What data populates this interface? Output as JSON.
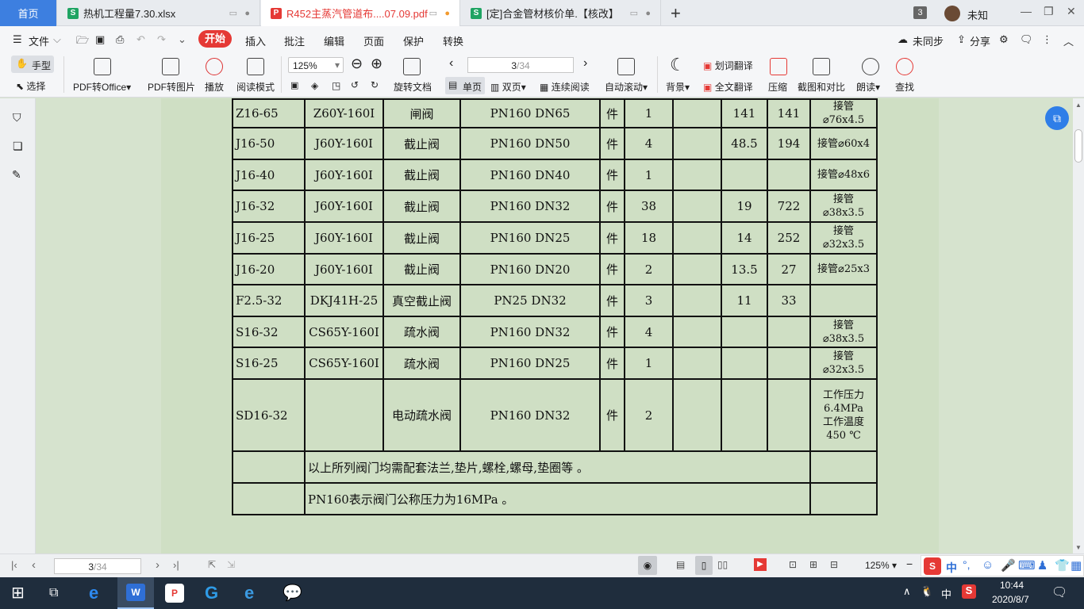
{
  "tabs": {
    "home": "首页",
    "xlsx": "热机工程量7.30.xlsx",
    "pdf": "R452主蒸汽管道布....07.09.pdf",
    "doc": "[定]合金管材核价单.【核改】",
    "count": "3",
    "user": "未知"
  },
  "menu": {
    "file": "文件",
    "start": "开始",
    "insert": "插入",
    "annotate": "批注",
    "edit": "编辑",
    "page": "页面",
    "protect": "保护",
    "convert": "转换",
    "sync": "未同步",
    "share": "分享"
  },
  "toolbar": {
    "hand": "手型",
    "select": "选择",
    "pdf_office": "PDF转Office",
    "pdf_img": "PDF转图片",
    "play": "播放",
    "read_mode": "阅读模式",
    "zoom": "125%",
    "page_current": "3",
    "page_total": "/34",
    "rotate": "旋转文档",
    "single": "单页",
    "double": "双页",
    "continuous": "连续阅读",
    "autoscroll": "自动滚动",
    "background": "背景",
    "word_translate": "划词翻译",
    "full_translate": "全文翻译",
    "compress": "压缩",
    "screenshot": "截图和对比",
    "read_aloud": "朗读",
    "find": "查找"
  },
  "table": {
    "rows": [
      {
        "code": "Z16-65",
        "model": "Z60Y-160I",
        "name": "闸阀",
        "spec": "PN160 DN65",
        "unit": "件",
        "qty": "1",
        "blank": "",
        "weight": "141",
        "total": "141",
        "note": "接管\n⌀76x4.5"
      },
      {
        "code": "J16-50",
        "model": "J60Y-160I",
        "name": "截止阀",
        "spec": "PN160 DN50",
        "unit": "件",
        "qty": "4",
        "blank": "",
        "weight": "48.5",
        "total": "194",
        "note": "接管⌀60x4"
      },
      {
        "code": "J16-40",
        "model": "J60Y-160I",
        "name": "截止阀",
        "spec": "PN160 DN40",
        "unit": "件",
        "qty": "1",
        "blank": "",
        "weight": "",
        "total": "",
        "note": "接管⌀48x6"
      },
      {
        "code": "J16-32",
        "model": "J60Y-160I",
        "name": "截止阀",
        "spec": "PN160 DN32",
        "unit": "件",
        "qty": "38",
        "blank": "",
        "weight": "19",
        "total": "722",
        "note": "接管\n⌀38x3.5"
      },
      {
        "code": "J16-25",
        "model": "J60Y-160I",
        "name": "截止阀",
        "spec": "PN160 DN25",
        "unit": "件",
        "qty": "18",
        "blank": "",
        "weight": "14",
        "total": "252",
        "note": "接管\n⌀32x3.5"
      },
      {
        "code": "J16-20",
        "model": "J60Y-160I",
        "name": "截止阀",
        "spec": "PN160 DN20",
        "unit": "件",
        "qty": "2",
        "blank": "",
        "weight": "13.5",
        "total": "27",
        "note": "接管⌀25x3"
      },
      {
        "code": "F2.5-32",
        "model": "DKJ41H-25",
        "name": "真空截止阀",
        "spec": "PN25 DN32",
        "unit": "件",
        "qty": "3",
        "blank": "",
        "weight": "11",
        "total": "33",
        "note": ""
      },
      {
        "code": "S16-32",
        "model": "CS65Y-160I",
        "name": "疏水阀",
        "spec": "PN160 DN32",
        "unit": "件",
        "qty": "4",
        "blank": "",
        "weight": "",
        "total": "",
        "note": "接管\n⌀38x3.5"
      },
      {
        "code": "S16-25",
        "model": "CS65Y-160I",
        "name": "疏水阀",
        "spec": "PN160 DN25",
        "unit": "件",
        "qty": "1",
        "blank": "",
        "weight": "",
        "total": "",
        "note": "接管\n⌀32x3.5"
      },
      {
        "code": "SD16-32",
        "model": "",
        "name": "电动疏水阀",
        "spec": "PN160 DN32",
        "unit": "件",
        "qty": "2",
        "blank": "",
        "weight": "",
        "total": "",
        "note": "工作压力\n6.4MPa\n工作温度\n450 ℃"
      }
    ],
    "footnote1": "以上所列阀门均需配套法兰,垫片,螺栓,螺母,垫圈等 。",
    "footnote2": "PN160表示阀门公称压力为16MPa 。"
  },
  "status": {
    "page_current": "3",
    "page_total": "/34",
    "zoom": "125%"
  },
  "taskbar": {
    "ime": "中",
    "clock_time": "10:44",
    "clock_date": "2020/8/7",
    "ime_cn": "中"
  }
}
